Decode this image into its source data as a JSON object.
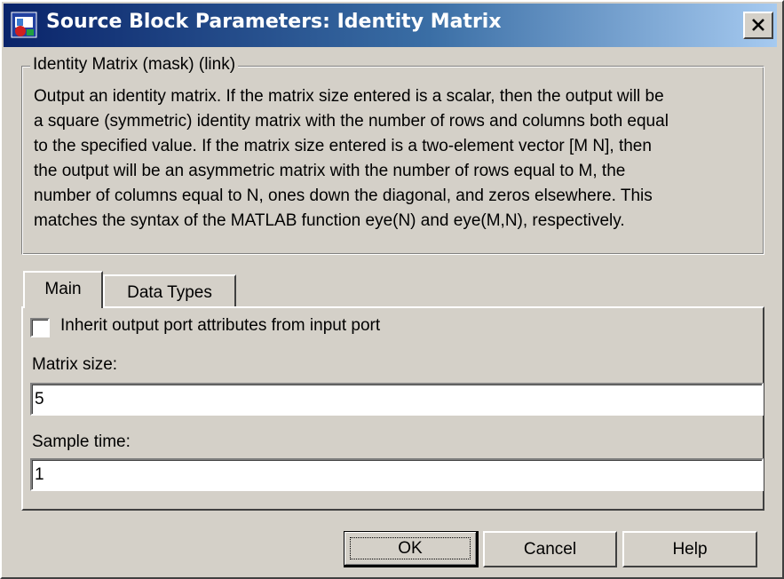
{
  "window": {
    "title": "Source Block Parameters: Identity Matrix",
    "close_icon": "close-x-icon",
    "app_icon": "simulink-block-icon"
  },
  "description": {
    "group_title": "Identity Matrix (mask) (link)",
    "lines": [
      "Output an identity matrix.  If the matrix size entered is a scalar, then the output will be",
      "a square (symmetric) identity matrix with the number of rows and columns both equal",
      "to the specified value.  If the matrix size entered is a two-element vector [M N], then",
      "the output will be an asymmetric matrix with the number of rows equal to M, the",
      "number of columns equal to N, ones down the diagonal, and zeros elsewhere.  This",
      "matches the syntax of the MATLAB function eye(N) and eye(M,N), respectively."
    ]
  },
  "tabs": [
    {
      "label": "Main",
      "active": true
    },
    {
      "label": "Data Types",
      "active": false
    }
  ],
  "main_tab": {
    "inherit_checkbox": {
      "label": "Inherit output port attributes from input port",
      "checked": false
    },
    "matrix_size": {
      "label": "Matrix size:",
      "value": "5"
    },
    "sample_time": {
      "label": "Sample time:",
      "value": "1"
    }
  },
  "buttons": {
    "ok": "OK",
    "cancel": "Cancel",
    "help": "Help"
  },
  "colors": {
    "face": "#d4d0c8",
    "title_start": "#0a246a",
    "title_end": "#a6caf0"
  }
}
